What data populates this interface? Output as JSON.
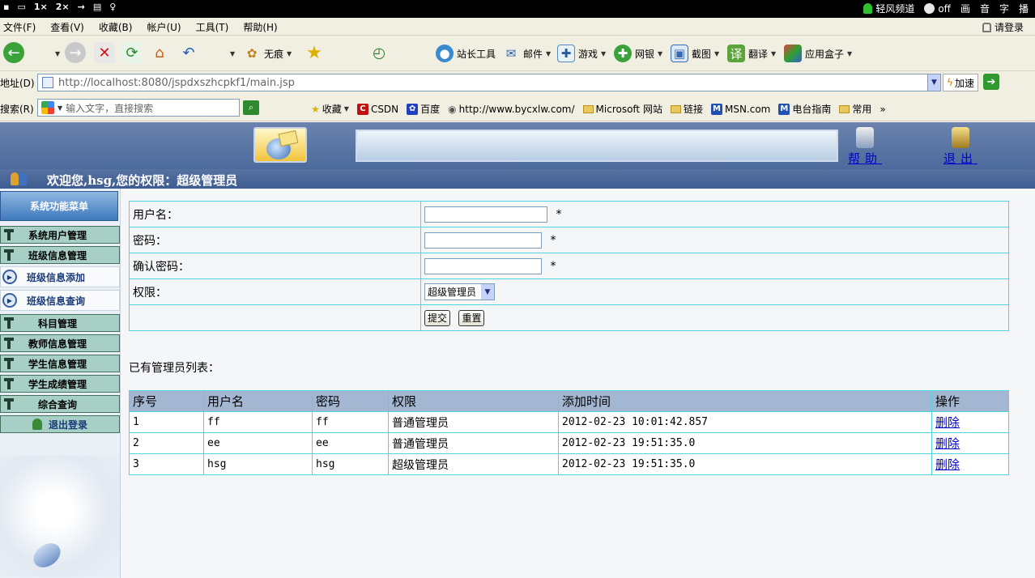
{
  "sysbar": {
    "left_items": [
      "2",
      "1×",
      "2×"
    ],
    "channel_label": "轻风频道",
    "toggle_label": "off",
    "right_items": [
      "画",
      "音",
      "字",
      "播"
    ]
  },
  "menubar": {
    "items": [
      "文件(F)",
      "查看(V)",
      "收藏(B)",
      "帐户(U)",
      "工具(T)",
      "帮助(H)"
    ],
    "login": "请登录"
  },
  "toolbar": {
    "wuhen": "无痕",
    "items": [
      "站长工具",
      "邮件",
      "游戏",
      "网银",
      "截图",
      "翻译",
      "应用盒子"
    ]
  },
  "addressbar": {
    "label": "地址(D)",
    "url": "http://localhost:8080/jspdxszhcpkf1/main.jsp",
    "speedup": "加速"
  },
  "linksbar": {
    "label": "搜索(R)",
    "search_placeholder": "输入文字，直接搜索",
    "links": [
      "收藏",
      "CSDN",
      "百度",
      "http://www.bycxlw.com/",
      "Microsoft 网站",
      "链接",
      "MSN.com",
      "电台指南",
      "常用"
    ],
    "more": "»"
  },
  "header": {
    "help": "帮助",
    "exit": "退出",
    "welcome": "欢迎您,hsg,您的权限：超级管理员"
  },
  "sidebar": {
    "title": "系统功能菜单",
    "items": [
      "系统用户管理",
      "班级信息管理",
      "班级信息添加",
      "班级信息查询",
      "科目管理",
      "教师信息管理",
      "学生信息管理",
      "学生成绩管理",
      "综合查询"
    ],
    "logout": "退出登录"
  },
  "form": {
    "username_label": "用户名：",
    "password_label": "密码：",
    "confirm_label": "确认密码：",
    "role_label": "权限：",
    "required_mark": "*",
    "role_value": "超级管理员",
    "submit": "提交",
    "reset": "重置"
  },
  "list": {
    "title": "已有管理员列表：",
    "headers": [
      "序号",
      "用户名",
      "密码",
      "权限",
      "添加时间",
      "操作"
    ],
    "rows": [
      [
        "1",
        "ff",
        "ff",
        "普通管理员",
        "2012-02-23 10:01:42.857",
        "删除"
      ],
      [
        "2",
        "ee",
        "ee",
        "普通管理员",
        "2012-02-23 19:51:35.0",
        "删除"
      ],
      [
        "3",
        "hsg",
        "hsg",
        "超级管理员",
        "2012-02-23 19:51:35.0",
        "删除"
      ]
    ]
  },
  "colors": {
    "banner": "#4c6a9c",
    "sidebar_item": "#a7cfc6",
    "table_border": "#4fd4e0",
    "table_header": "#a3b6d2",
    "link": "#0000cc"
  }
}
